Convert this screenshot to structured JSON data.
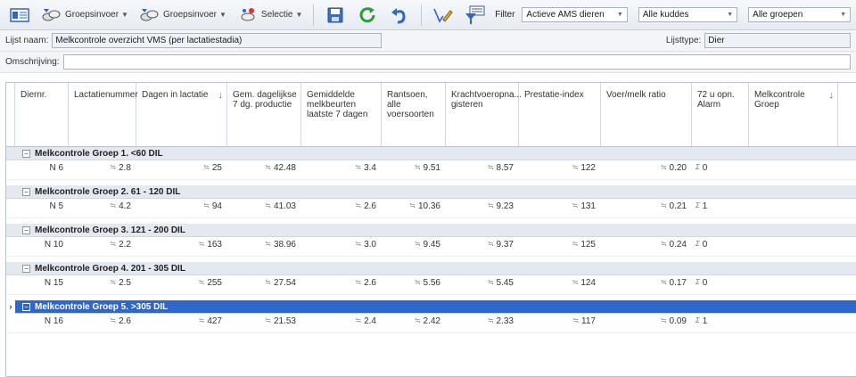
{
  "toolbar": {
    "group_entry_1": "Groepsinvoer",
    "group_entry_2": "Groepsinvoer",
    "selection": "Selectie",
    "filter_label": "Filter",
    "filter_select": "Actieve AMS dieren",
    "herd_select": "Alle kuddes",
    "group_select": "Alle groepen"
  },
  "form": {
    "list_name_label": "Lijst naam:",
    "list_name_value": "Melkcontrole overzicht VMS (per lactatiestadia)",
    "list_type_label": "Lijsttype:",
    "list_type_value": "Dier",
    "description_label": "Omschrijving:",
    "description_value": ""
  },
  "columns": [
    "Diernr.",
    "Lactatienummer",
    "Dagen in lactatie",
    "Gem. dagelijkse 7 dg. productie",
    "Gemiddelde melkbeurten laatste 7 dagen",
    "Rantsoen, alle voersoorten",
    "Krachtvoeropna... gisteren",
    "Prestatie-index",
    "Voer/melk ratio",
    "72 u opn. Alarm",
    "Melkcontrole Groep"
  ],
  "groups": [
    {
      "title": "Melkcontrole Groep  1. <60 DIL",
      "n": "N 6",
      "lact": "2.8",
      "days": "25",
      "prod": "42.48",
      "milkings": "3.4",
      "ration": "9.51",
      "conc": "8.57",
      "perf": "122",
      "ratio": "0.20",
      "alarm": "0"
    },
    {
      "title": "Melkcontrole Groep  2. 61 - 120 DIL",
      "n": "N 5",
      "lact": "4.2",
      "days": "94",
      "prod": "41.03",
      "milkings": "2.6",
      "ration": "10.36",
      "conc": "9.23",
      "perf": "131",
      "ratio": "0.21",
      "alarm": "1"
    },
    {
      "title": "Melkcontrole Groep  3. 121 - 200 DIL",
      "n": "N 10",
      "lact": "2.2",
      "days": "163",
      "prod": "38.96",
      "milkings": "3.0",
      "ration": "9.45",
      "conc": "9.37",
      "perf": "125",
      "ratio": "0.24",
      "alarm": "0"
    },
    {
      "title": "Melkcontrole Groep  4. 201 - 305 DIL",
      "n": "N 15",
      "lact": "2.5",
      "days": "255",
      "prod": "27.54",
      "milkings": "2.6",
      "ration": "5.56",
      "conc": "5.45",
      "perf": "124",
      "ratio": "0.17",
      "alarm": "0"
    },
    {
      "title": "Melkcontrole Groep  5. >305 DIL",
      "n": "N 16",
      "lact": "2.6",
      "days": "427",
      "prod": "21.53",
      "milkings": "2.4",
      "ration": "2.42",
      "conc": "2.33",
      "perf": "117",
      "ratio": "0.09",
      "alarm": "1"
    }
  ],
  "colors": {
    "selected_row": "#2f66c9",
    "group_band": "#e4e9f0",
    "sort_arrow": "#3a6fd0"
  },
  "icons": {
    "agg_avg": "≒",
    "agg_count": "N",
    "agg_sum": "Σ"
  }
}
